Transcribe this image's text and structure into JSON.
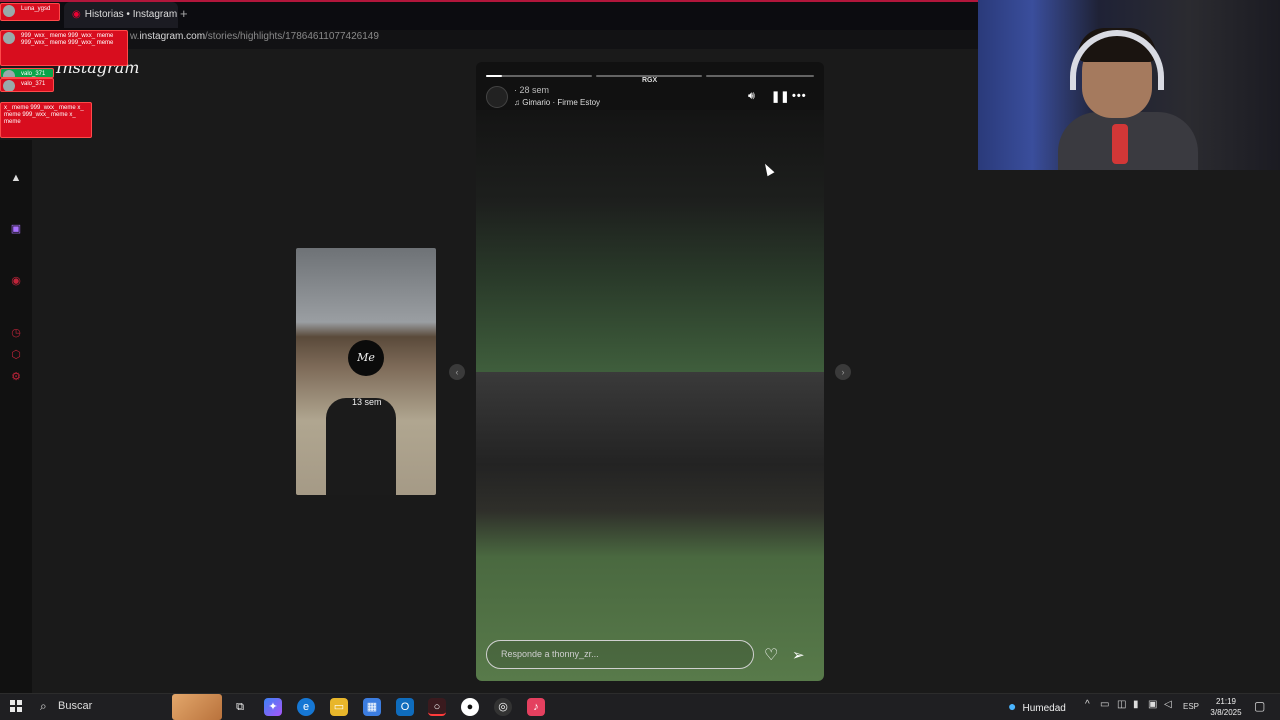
{
  "browser": {
    "tab_title": "Historias • Instagram",
    "new_tab_symbol": "+",
    "url_prefix": "w.",
    "url_domain": "instagram.com",
    "url_path": "/stories/highlights/17864611077426149"
  },
  "instagram": {
    "logo_text": "Instagram"
  },
  "chat_overlays": [
    {
      "text": "Luna_ygsd",
      "color": "red"
    },
    {
      "text": "999_wxx_ meme 999_wxx_ meme 999_wxx_ meme 999_wxx_ meme",
      "color": "red"
    },
    {
      "text": "valo_371",
      "color": "green"
    },
    {
      "text": "valo_371",
      "color": "red"
    },
    {
      "text": "x_ meme 999_wxx_ meme x_ meme 999_wxx_ meme x_ meme",
      "color": "red"
    }
  ],
  "story": {
    "progress_segments": [
      {
        "fill_fraction": 0.15
      },
      {
        "fill_fraction": 0
      },
      {
        "fill_fraction": 0
      }
    ],
    "badge": "RGX",
    "time_ago": "28 sem",
    "song": "Gimario · Firme Estoy",
    "volume_icon": "volume-icon",
    "pause_icon": "pause-icon",
    "more_icon": "more-options-icon",
    "reply_placeholder": "Responde a thonny_zr...",
    "heart_icon": "heart-icon",
    "send_icon": "send-icon"
  },
  "preview": {
    "avatar_text": "Me",
    "time_ago": "13 sem"
  },
  "taskbar": {
    "search_label": "Buscar",
    "weather_label": "Humedad",
    "language": "ESP",
    "time": "21:19",
    "date": "3/8/2025"
  },
  "colors": {
    "accent_red": "#d80d1e",
    "chat_green": "#0aa54a",
    "page_bg": "#1a1a1a"
  }
}
